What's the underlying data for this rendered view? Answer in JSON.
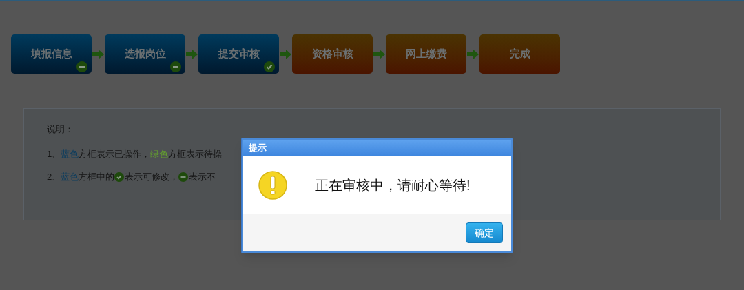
{
  "steps": [
    {
      "label": "填报信息",
      "kind": "done",
      "badge": {
        "kind": "minus"
      }
    },
    {
      "label": "选报岗位",
      "kind": "done",
      "badge": {
        "kind": "minus"
      }
    },
    {
      "label": "提交审核",
      "kind": "done",
      "badge": {
        "kind": "check"
      }
    },
    {
      "label": "资格审核",
      "kind": "pending"
    },
    {
      "label": "网上缴费",
      "kind": "pending"
    },
    {
      "label": "完成",
      "kind": "pending"
    }
  ],
  "notes": {
    "title": "说明：",
    "lines": [
      [
        {
          "kind": "text",
          "text": "1、"
        },
        {
          "kind": "blue",
          "text": "蓝色"
        },
        {
          "kind": "text",
          "text": "方框表示已操作， "
        },
        {
          "kind": "green",
          "text": "绿色"
        },
        {
          "kind": "text",
          "text": "方框表示待操"
        }
      ],
      [
        {
          "kind": "text",
          "text": "2、"
        },
        {
          "kind": "blue",
          "text": "蓝色"
        },
        {
          "kind": "text",
          "text": "方框中的 "
        },
        {
          "kind": "check"
        },
        {
          "kind": "text",
          "text": "表示可修改，"
        },
        {
          "kind": "minus"
        },
        {
          "kind": "text",
          "text": "表示不"
        }
      ]
    ]
  },
  "dialog": {
    "title": "提示",
    "message": "正在审核中，请耐心等待!",
    "button": "确定"
  }
}
